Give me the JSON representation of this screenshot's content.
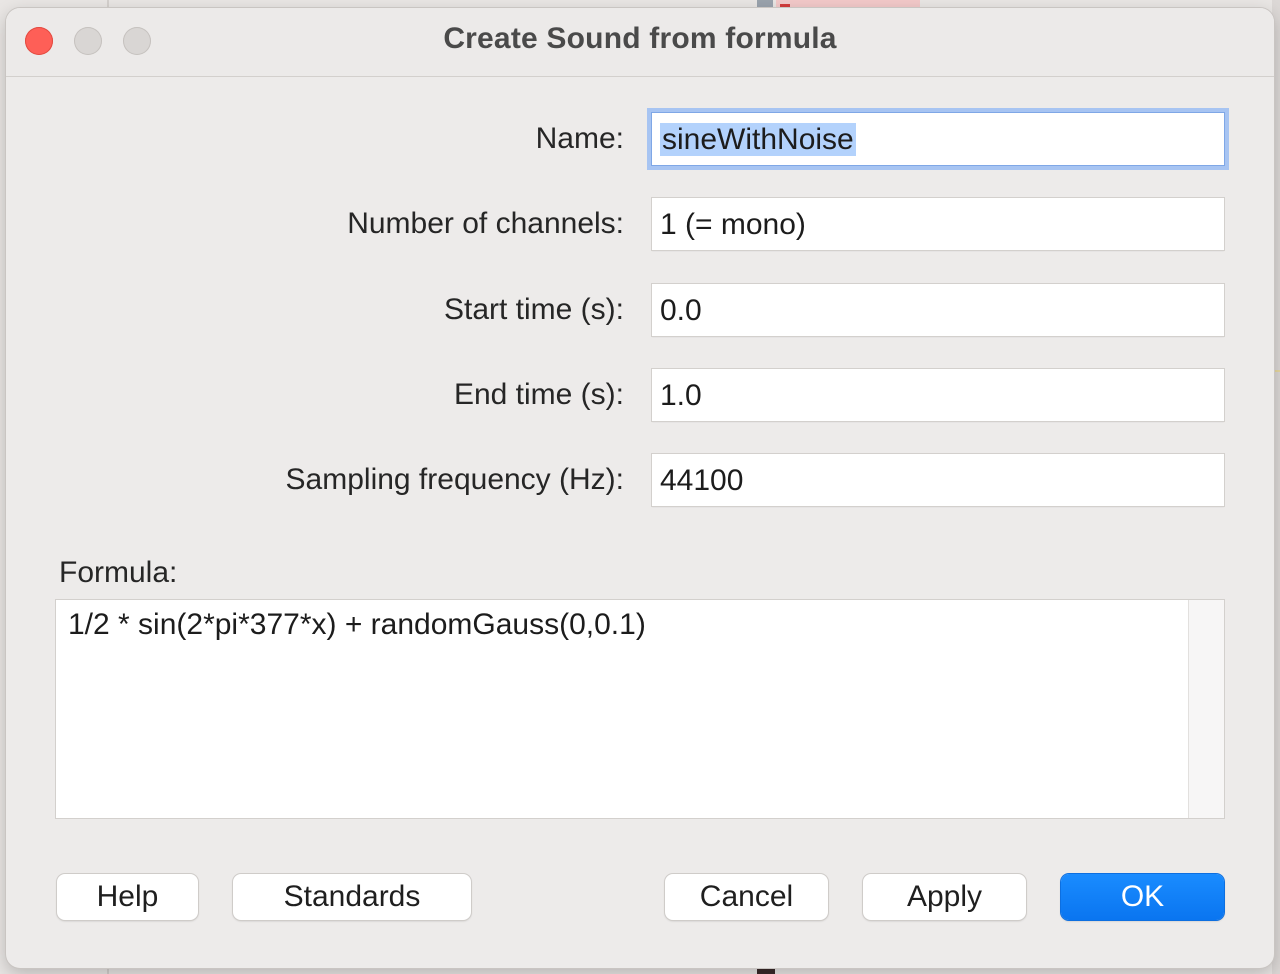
{
  "window": {
    "title": "Create Sound from formula"
  },
  "fields": [
    {
      "label": "Name:",
      "value": "sineWithNoise"
    },
    {
      "label": "Number of channels:",
      "value": "1 (= mono)"
    },
    {
      "label": "Start time (s):",
      "value": "0.0"
    },
    {
      "label": "End time (s):",
      "value": "1.0"
    },
    {
      "label": "Sampling frequency (Hz):",
      "value": "44100"
    }
  ],
  "formula": {
    "label": "Formula:",
    "value": "1/2 * sin(2*pi*377*x) + randomGauss(0,0.1)"
  },
  "buttons": {
    "help": "Help",
    "standards": "Standards",
    "cancel": "Cancel",
    "apply": "Apply",
    "ok": "OK"
  },
  "colors": {
    "accent": "#0a7aff",
    "close": "#fe5f57",
    "selection": "#b3d2fc"
  }
}
